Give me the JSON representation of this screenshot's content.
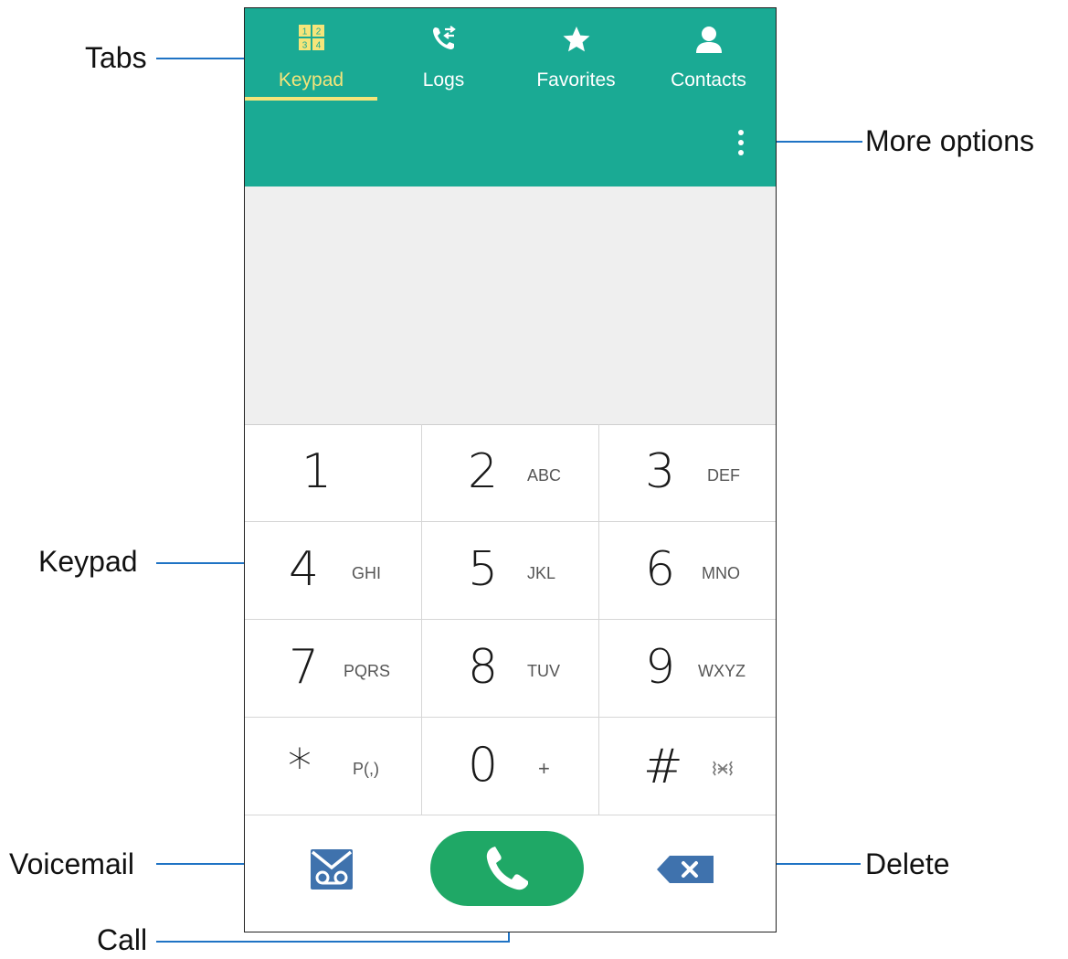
{
  "tabs": [
    {
      "label": "Keypad",
      "icon": "keypad-icon",
      "active": true
    },
    {
      "label": "Logs",
      "icon": "logs-icon",
      "active": false
    },
    {
      "label": "Favorites",
      "icon": "star-icon",
      "active": false
    },
    {
      "label": "Contacts",
      "icon": "person-icon",
      "active": false
    }
  ],
  "keypad_icon_digits": [
    "1",
    "2",
    "3",
    "4"
  ],
  "keys": [
    {
      "digit": "1",
      "letters": ""
    },
    {
      "digit": "2",
      "letters": "ABC"
    },
    {
      "digit": "3",
      "letters": "DEF"
    },
    {
      "digit": "4",
      "letters": "GHI"
    },
    {
      "digit": "5",
      "letters": "JKL"
    },
    {
      "digit": "6",
      "letters": "MNO"
    },
    {
      "digit": "7",
      "letters": "PQRS"
    },
    {
      "digit": "8",
      "letters": "TUV"
    },
    {
      "digit": "9",
      "letters": "WXYZ"
    },
    {
      "digit": "*",
      "letters": "P(,)"
    },
    {
      "digit": "0",
      "letters": "+"
    },
    {
      "digit": "#",
      "letters": ""
    }
  ],
  "callouts": {
    "tabs": "Tabs",
    "more_options": "More options",
    "keypad": "Keypad",
    "voicemail": "Voicemail",
    "delete": "Delete",
    "call": "Call"
  },
  "colors": {
    "header": "#1aaa94",
    "active_tab": "#f5e57a",
    "call_button": "#1fa866",
    "icon_blue": "#3f72ad",
    "callout_line": "#1f73c4"
  }
}
